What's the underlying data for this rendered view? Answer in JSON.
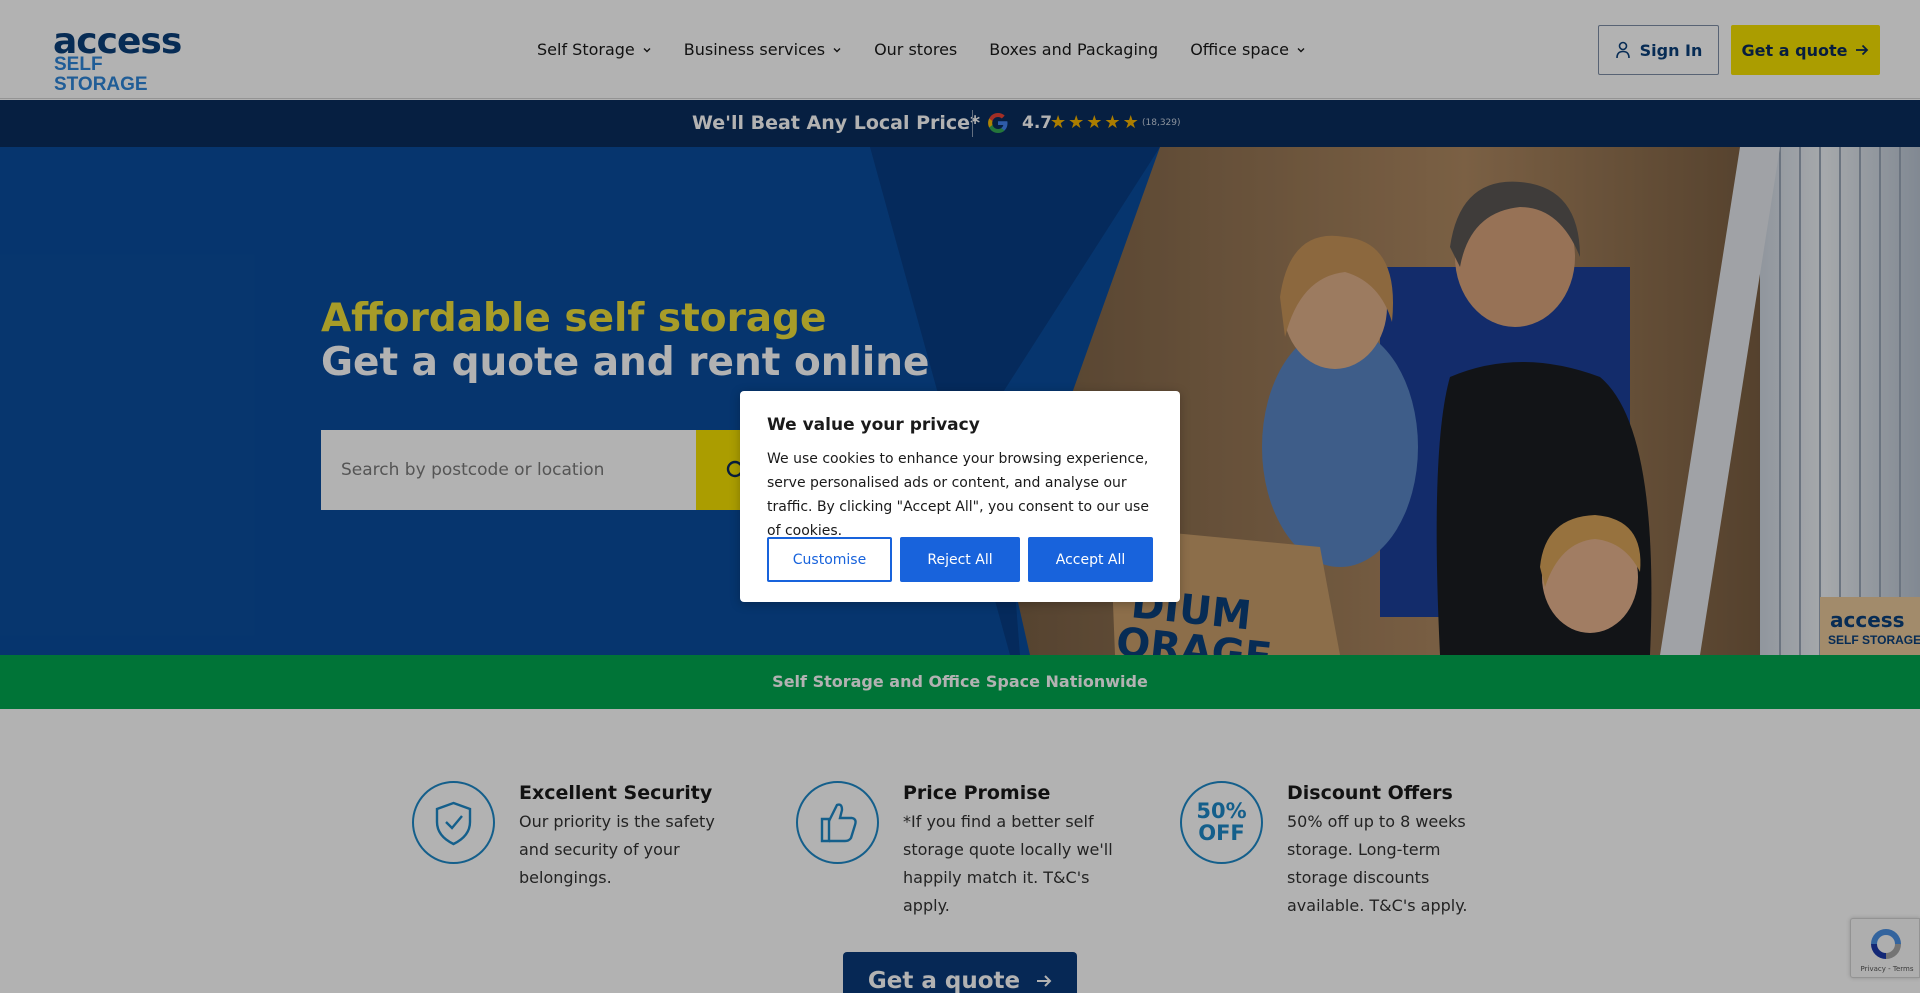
{
  "brand": {
    "logo_top": "access",
    "logo_bottom": "SELF STORAGE",
    "primary_color": "#0b3f7a",
    "accent_color": "#f5e100"
  },
  "nav": {
    "items": [
      {
        "label": "Self Storage",
        "dropdown": true
      },
      {
        "label": "Business services",
        "dropdown": true
      },
      {
        "label": "Our stores",
        "dropdown": false
      },
      {
        "label": "Boxes and Packaging",
        "dropdown": false
      },
      {
        "label": "Office space",
        "dropdown": true
      }
    ],
    "sign_in_label": "Sign In",
    "get_quote_label": "Get a quote"
  },
  "promo": {
    "text": "We'll Beat Any Local Price*",
    "rating": "4.7",
    "stars": 5,
    "review_count": "(18,329)",
    "icons": [
      "google-icon"
    ]
  },
  "hero": {
    "headline": "Affordable self storage",
    "subheadline": "Get a quote and rent online",
    "search_placeholder": "Search by postcode or location",
    "headline_color": "#f0e03a"
  },
  "banner": {
    "text": "Self Storage and Office Space Nationwide",
    "color": "#00a650"
  },
  "features": [
    {
      "title": "Excellent Security",
      "body": "Our priority is the safety and security of your belongings.",
      "icon": "shield-icon"
    },
    {
      "title": "Price Promise",
      "body": "*If you find a better self storage quote locally we'll happily match it. T&C's apply.",
      "icon": "thumbs-up-icon"
    },
    {
      "title": "Discount Offers",
      "body": "50% off up to 8 weeks storage. Long-term storage discounts available. T&C's apply.",
      "icon": "discount-icon",
      "icon_text_top": "50%",
      "icon_text_bottom": "OFF"
    }
  ],
  "bottom_cta": {
    "label": "Get a quote"
  },
  "recaptcha": {
    "text": "Privacy - Terms"
  },
  "cookie_modal": {
    "title": "We value your privacy",
    "body": "We use cookies to enhance your browsing experience, serve personalised ads or content, and analyse our traffic. By clicking \"Accept All\", you consent to our use of cookies.",
    "customise_label": "Customise",
    "reject_label": "Reject All",
    "accept_label": "Accept All",
    "button_color": "#1863dc"
  },
  "hero_photo": {
    "box_text_1": "DIUM",
    "box_text_2": "ORAGE",
    "sign_text_1": "access",
    "sign_text_2": "SELF STORAGE"
  }
}
